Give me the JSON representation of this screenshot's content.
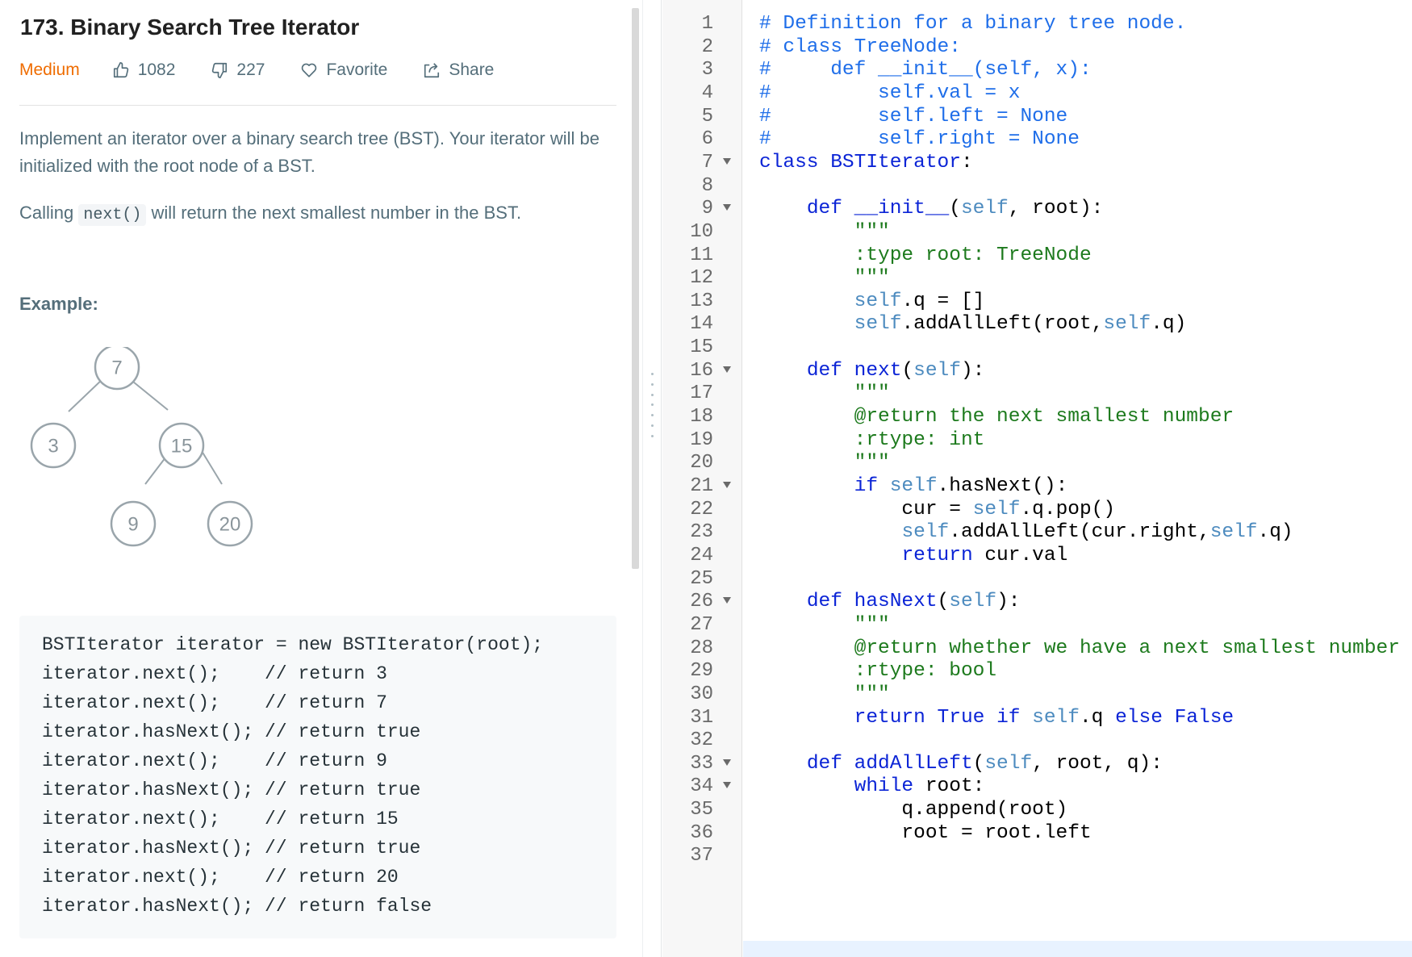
{
  "problem": {
    "title": "173. Binary Search Tree Iterator",
    "difficulty": "Medium",
    "likes": "1082",
    "dislikes": "227",
    "favorite_label": "Favorite",
    "share_label": "Share",
    "description_1": "Implement an iterator over a binary search tree (BST). Your iterator will be initialized with the root node of a BST.",
    "description_2_pre": "Calling",
    "description_2_code": "next()",
    "description_2_post": "will return the next smallest number in the BST.",
    "example_heading": "Example:",
    "tree_nodes": [
      "7",
      "3",
      "15",
      "9",
      "20"
    ],
    "example_code": [
      "BSTIterator iterator = new BSTIterator(root);",
      "iterator.next();    // return 3",
      "iterator.next();    // return 7",
      "iterator.hasNext(); // return true",
      "iterator.next();    // return 9",
      "iterator.hasNext(); // return true",
      "iterator.next();    // return 15",
      "iterator.hasNext(); // return true",
      "iterator.next();    // return 20",
      "iterator.hasNext(); // return false"
    ]
  },
  "editor": {
    "colors": {
      "comment": "#1f6ee9",
      "keyword": "#0b24d6",
      "self": "#4d8bbf",
      "docstring": "#1d7a1d",
      "active_line": "#e8f2ff"
    },
    "lines": [
      {
        "n": "1",
        "fold": false,
        "tokens": [
          [
            "c",
            "# Definition for a binary tree node."
          ]
        ]
      },
      {
        "n": "2",
        "fold": false,
        "tokens": [
          [
            "c",
            "# class TreeNode:"
          ]
        ]
      },
      {
        "n": "3",
        "fold": false,
        "tokens": [
          [
            "c",
            "#     def __init__(self, x):"
          ]
        ]
      },
      {
        "n": "4",
        "fold": false,
        "tokens": [
          [
            "c",
            "#         self.val = x"
          ]
        ]
      },
      {
        "n": "5",
        "fold": false,
        "tokens": [
          [
            "c",
            "#         self.left = None"
          ]
        ]
      },
      {
        "n": "6",
        "fold": false,
        "tokens": [
          [
            "c",
            "#         self.right = None"
          ]
        ]
      },
      {
        "n": "7",
        "fold": true,
        "tokens": [
          [
            "k",
            "class"
          ],
          [
            "p",
            " "
          ],
          [
            "f",
            "BSTIterator"
          ],
          [
            "p",
            ":"
          ]
        ]
      },
      {
        "n": "8",
        "fold": false,
        "tokens": []
      },
      {
        "n": "9",
        "fold": true,
        "tokens": [
          [
            "p",
            "    "
          ],
          [
            "k",
            "def"
          ],
          [
            "p",
            " "
          ],
          [
            "f",
            "__init__"
          ],
          [
            "p",
            "("
          ],
          [
            "s",
            "self"
          ],
          [
            "p",
            ", root):"
          ]
        ]
      },
      {
        "n": "10",
        "fold": false,
        "tokens": [
          [
            "d",
            "        \"\"\""
          ]
        ]
      },
      {
        "n": "11",
        "fold": false,
        "tokens": [
          [
            "d",
            "        :type root: TreeNode"
          ]
        ]
      },
      {
        "n": "12",
        "fold": false,
        "tokens": [
          [
            "d",
            "        \"\"\""
          ]
        ]
      },
      {
        "n": "13",
        "fold": false,
        "tokens": [
          [
            "p",
            "        "
          ],
          [
            "s",
            "self"
          ],
          [
            "p",
            ".q = []"
          ]
        ]
      },
      {
        "n": "14",
        "fold": false,
        "tokens": [
          [
            "p",
            "        "
          ],
          [
            "s",
            "self"
          ],
          [
            "p",
            ".addAllLeft(root,"
          ],
          [
            "s",
            "self"
          ],
          [
            "p",
            ".q)"
          ]
        ]
      },
      {
        "n": "15",
        "fold": false,
        "tokens": []
      },
      {
        "n": "16",
        "fold": true,
        "tokens": [
          [
            "p",
            "    "
          ],
          [
            "k",
            "def"
          ],
          [
            "p",
            " "
          ],
          [
            "f",
            "next"
          ],
          [
            "p",
            "("
          ],
          [
            "s",
            "self"
          ],
          [
            "p",
            "):"
          ]
        ]
      },
      {
        "n": "17",
        "fold": false,
        "tokens": [
          [
            "d",
            "        \"\"\""
          ]
        ]
      },
      {
        "n": "18",
        "fold": false,
        "tokens": [
          [
            "d",
            "        @return the next smallest number"
          ]
        ]
      },
      {
        "n": "19",
        "fold": false,
        "tokens": [
          [
            "d",
            "        :rtype: int"
          ]
        ]
      },
      {
        "n": "20",
        "fold": false,
        "tokens": [
          [
            "d",
            "        \"\"\""
          ]
        ]
      },
      {
        "n": "21",
        "fold": true,
        "tokens": [
          [
            "p",
            "        "
          ],
          [
            "k",
            "if"
          ],
          [
            "p",
            " "
          ],
          [
            "s",
            "self"
          ],
          [
            "p",
            ".hasNext():"
          ]
        ]
      },
      {
        "n": "22",
        "fold": false,
        "tokens": [
          [
            "p",
            "            cur = "
          ],
          [
            "s",
            "self"
          ],
          [
            "p",
            ".q.pop()"
          ]
        ]
      },
      {
        "n": "23",
        "fold": false,
        "tokens": [
          [
            "p",
            "            "
          ],
          [
            "s",
            "self"
          ],
          [
            "p",
            ".addAllLeft(cur.right,"
          ],
          [
            "s",
            "self"
          ],
          [
            "p",
            ".q)"
          ]
        ]
      },
      {
        "n": "24",
        "fold": false,
        "tokens": [
          [
            "p",
            "            "
          ],
          [
            "k",
            "return"
          ],
          [
            "p",
            " cur.val"
          ]
        ]
      },
      {
        "n": "25",
        "fold": false,
        "tokens": []
      },
      {
        "n": "26",
        "fold": true,
        "tokens": [
          [
            "p",
            "    "
          ],
          [
            "k",
            "def"
          ],
          [
            "p",
            " "
          ],
          [
            "f",
            "hasNext"
          ],
          [
            "p",
            "("
          ],
          [
            "s",
            "self"
          ],
          [
            "p",
            "):"
          ]
        ]
      },
      {
        "n": "27",
        "fold": false,
        "tokens": [
          [
            "d",
            "        \"\"\""
          ]
        ]
      },
      {
        "n": "28",
        "fold": false,
        "tokens": [
          [
            "d",
            "        @return whether we have a next smallest number"
          ]
        ]
      },
      {
        "n": "29",
        "fold": false,
        "tokens": [
          [
            "d",
            "        :rtype: bool"
          ]
        ]
      },
      {
        "n": "30",
        "fold": false,
        "tokens": [
          [
            "d",
            "        \"\"\""
          ]
        ]
      },
      {
        "n": "31",
        "fold": false,
        "tokens": [
          [
            "p",
            "        "
          ],
          [
            "k",
            "return"
          ],
          [
            "p",
            " "
          ],
          [
            "k",
            "True"
          ],
          [
            "p",
            " "
          ],
          [
            "k",
            "if"
          ],
          [
            "p",
            " "
          ],
          [
            "s",
            "self"
          ],
          [
            "p",
            ".q "
          ],
          [
            "k",
            "else"
          ],
          [
            "p",
            " "
          ],
          [
            "k",
            "False"
          ]
        ]
      },
      {
        "n": "32",
        "fold": false,
        "tokens": []
      },
      {
        "n": "33",
        "fold": true,
        "tokens": [
          [
            "p",
            "    "
          ],
          [
            "k",
            "def"
          ],
          [
            "p",
            " "
          ],
          [
            "f",
            "addAllLeft"
          ],
          [
            "p",
            "("
          ],
          [
            "s",
            "self"
          ],
          [
            "p",
            ", root, q):"
          ]
        ]
      },
      {
        "n": "34",
        "fold": true,
        "tokens": [
          [
            "p",
            "        "
          ],
          [
            "k",
            "while"
          ],
          [
            "p",
            " root:"
          ]
        ]
      },
      {
        "n": "35",
        "fold": false,
        "tokens": [
          [
            "p",
            "            q.append(root)"
          ]
        ]
      },
      {
        "n": "36",
        "fold": false,
        "tokens": [
          [
            "p",
            "            root = root.left"
          ]
        ]
      },
      {
        "n": "37",
        "fold": false,
        "tokens": []
      }
    ]
  }
}
